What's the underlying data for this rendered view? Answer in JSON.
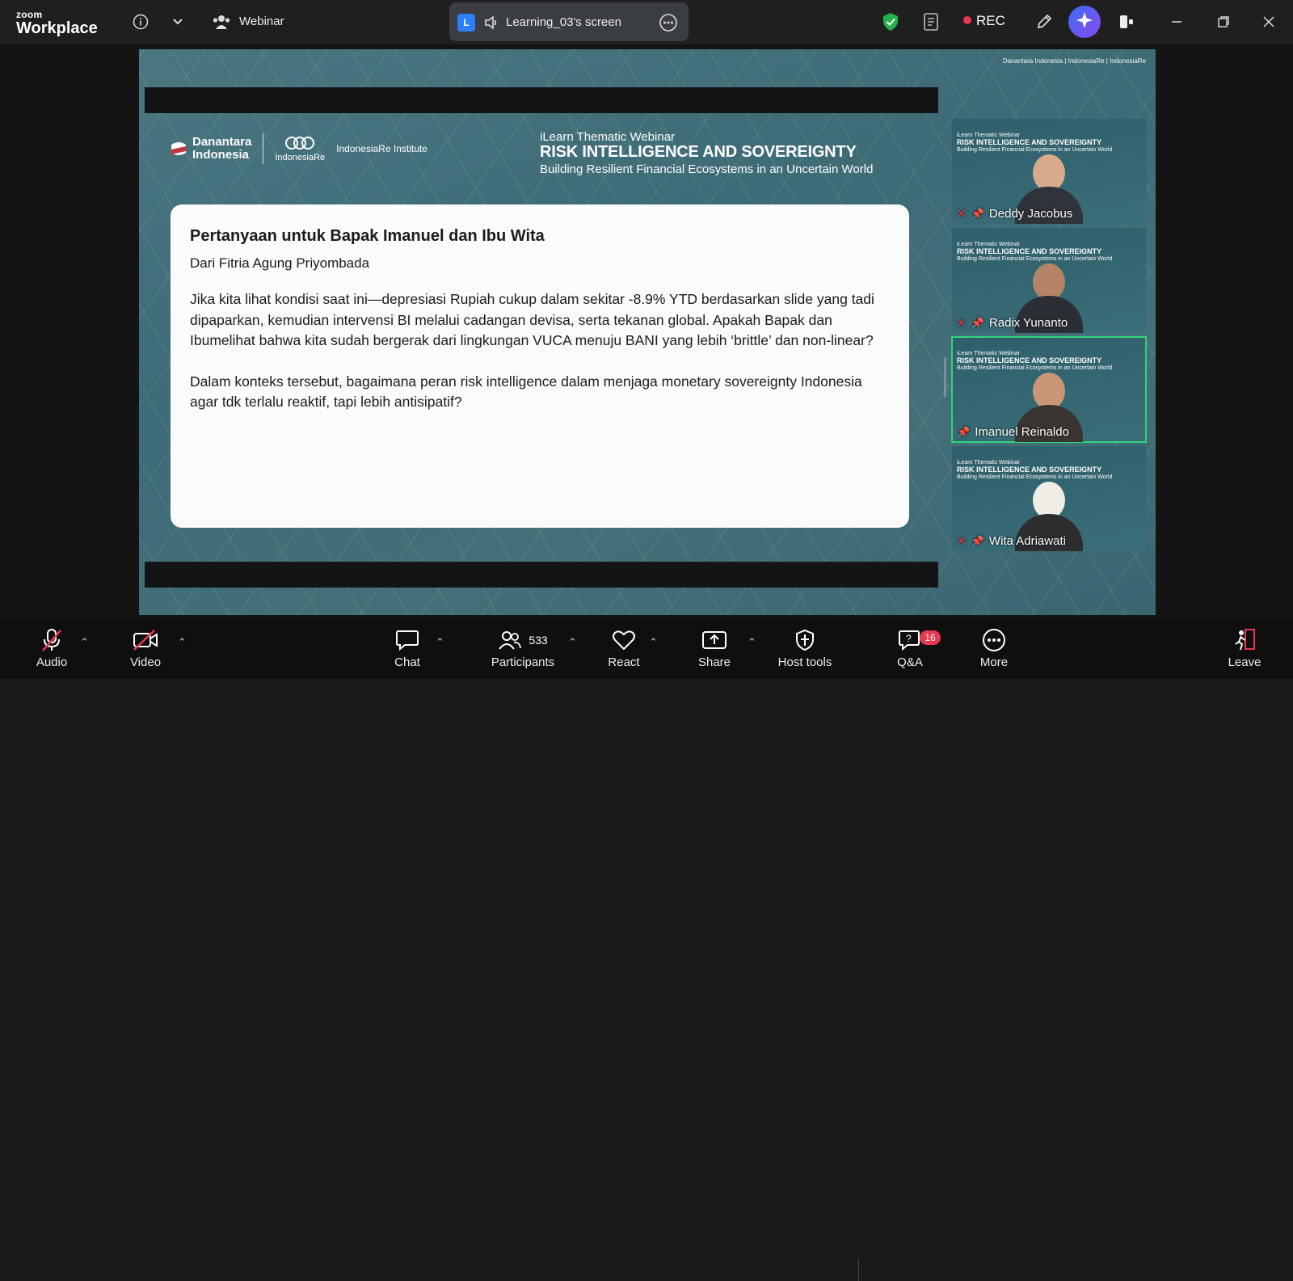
{
  "app": {
    "logo_small": "zoom",
    "logo_large": "Workplace",
    "webinar_label": "Webinar"
  },
  "screen_share": {
    "badge": "L",
    "label": "Learning_03's screen"
  },
  "recording": {
    "label": "REC"
  },
  "slide": {
    "brand": {
      "line1": "Danantara",
      "line2": "Indonesia",
      "partner1": "IndonesiaRe",
      "partner2": "IndonesiaRe Institute"
    },
    "corner_logos": "Danantara Indonesia | IndonesiaRe | IndonesiaRe",
    "heading": {
      "eyebrow": "iLearn Thematic Webinar",
      "title": "RISK INTELLIGENCE AND SOVEREIGNTY",
      "subtitle": "Building Resilient Financial Ecosystems in an Uncertain World"
    },
    "question": {
      "title": "Pertanyaan untuk Bapak Imanuel dan Ibu Wita",
      "from": "Dari Fitria Agung Priyombada",
      "paragraph1": "Jika kita lihat kondisi saat ini—depresiasi Rupiah cukup dalam sekitar -8.9% YTD berdasarkan slide yang tadi dipaparkan, kemudian intervensi BI melalui cadangan devisa, serta tekanan global. Apakah Bapak dan Ibumelihat bahwa kita sudah bergerak dari lingkungan VUCA menuju BANI yang lebih ‘brittle’ dan non-linear?",
      "paragraph2": "Dalam konteks tersebut, bagaimana peran risk intelligence dalam menjaga monetary sovereignty Indonesia agar tdk terlalu reaktif, tapi lebih antisipatif?"
    }
  },
  "tile_text": {
    "eyebrow": "iLearn Thematic Webinar",
    "title": "RISK INTELLIGENCE AND SOVEREIGNTY",
    "subtitle": "Building Resilient Financial Ecosystems in an Uncertain World"
  },
  "participants_tiles": [
    {
      "name": "Deddy Jacobus"
    },
    {
      "name": "Radix Yunanto"
    },
    {
      "name": "Imanuel Reinaldo"
    },
    {
      "name": "Wita Adriawati"
    }
  ],
  "toolbar": {
    "audio": "Audio",
    "video": "Video",
    "chat": "Chat",
    "participants": "Participants",
    "participants_count": "533",
    "react": "React",
    "share": "Share",
    "host_tools": "Host tools",
    "qa": "Q&A",
    "qa_badge": "16",
    "more": "More",
    "leave": "Leave"
  },
  "colors": {
    "accent_green": "#2ed47a",
    "rec_red": "#e8384f",
    "leave_red": "#e8384f"
  }
}
